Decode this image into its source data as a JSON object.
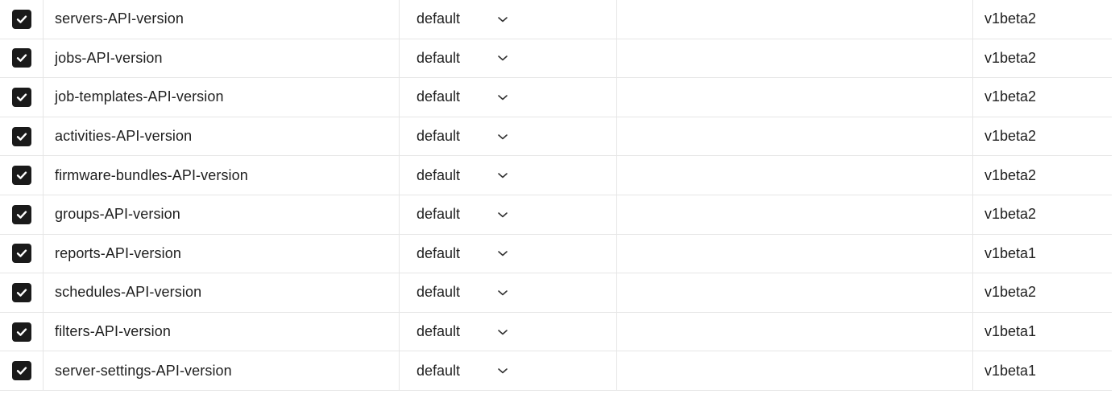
{
  "rows": [
    {
      "name": "servers-API-version",
      "checked": true,
      "selected": "default",
      "version": "v1beta2"
    },
    {
      "name": "jobs-API-version",
      "checked": true,
      "selected": "default",
      "version": "v1beta2"
    },
    {
      "name": "job-templates-API-version",
      "checked": true,
      "selected": "default",
      "version": "v1beta2"
    },
    {
      "name": "activities-API-version",
      "checked": true,
      "selected": "default",
      "version": "v1beta2"
    },
    {
      "name": "firmware-bundles-API-version",
      "checked": true,
      "selected": "default",
      "version": "v1beta2"
    },
    {
      "name": "groups-API-version",
      "checked": true,
      "selected": "default",
      "version": "v1beta2"
    },
    {
      "name": "reports-API-version",
      "checked": true,
      "selected": "default",
      "version": "v1beta1"
    },
    {
      "name": "schedules-API-version",
      "checked": true,
      "selected": "default",
      "version": "v1beta2"
    },
    {
      "name": "filters-API-version",
      "checked": true,
      "selected": "default",
      "version": "v1beta1"
    },
    {
      "name": "server-settings-API-version",
      "checked": true,
      "selected": "default",
      "version": "v1beta1"
    }
  ],
  "icons": {
    "checkbox": "check-icon",
    "dropdown": "chevron-down-icon"
  },
  "colors": {
    "checkbox_fill": "#1a1a1a",
    "grid_line": "#e6e6e6"
  }
}
